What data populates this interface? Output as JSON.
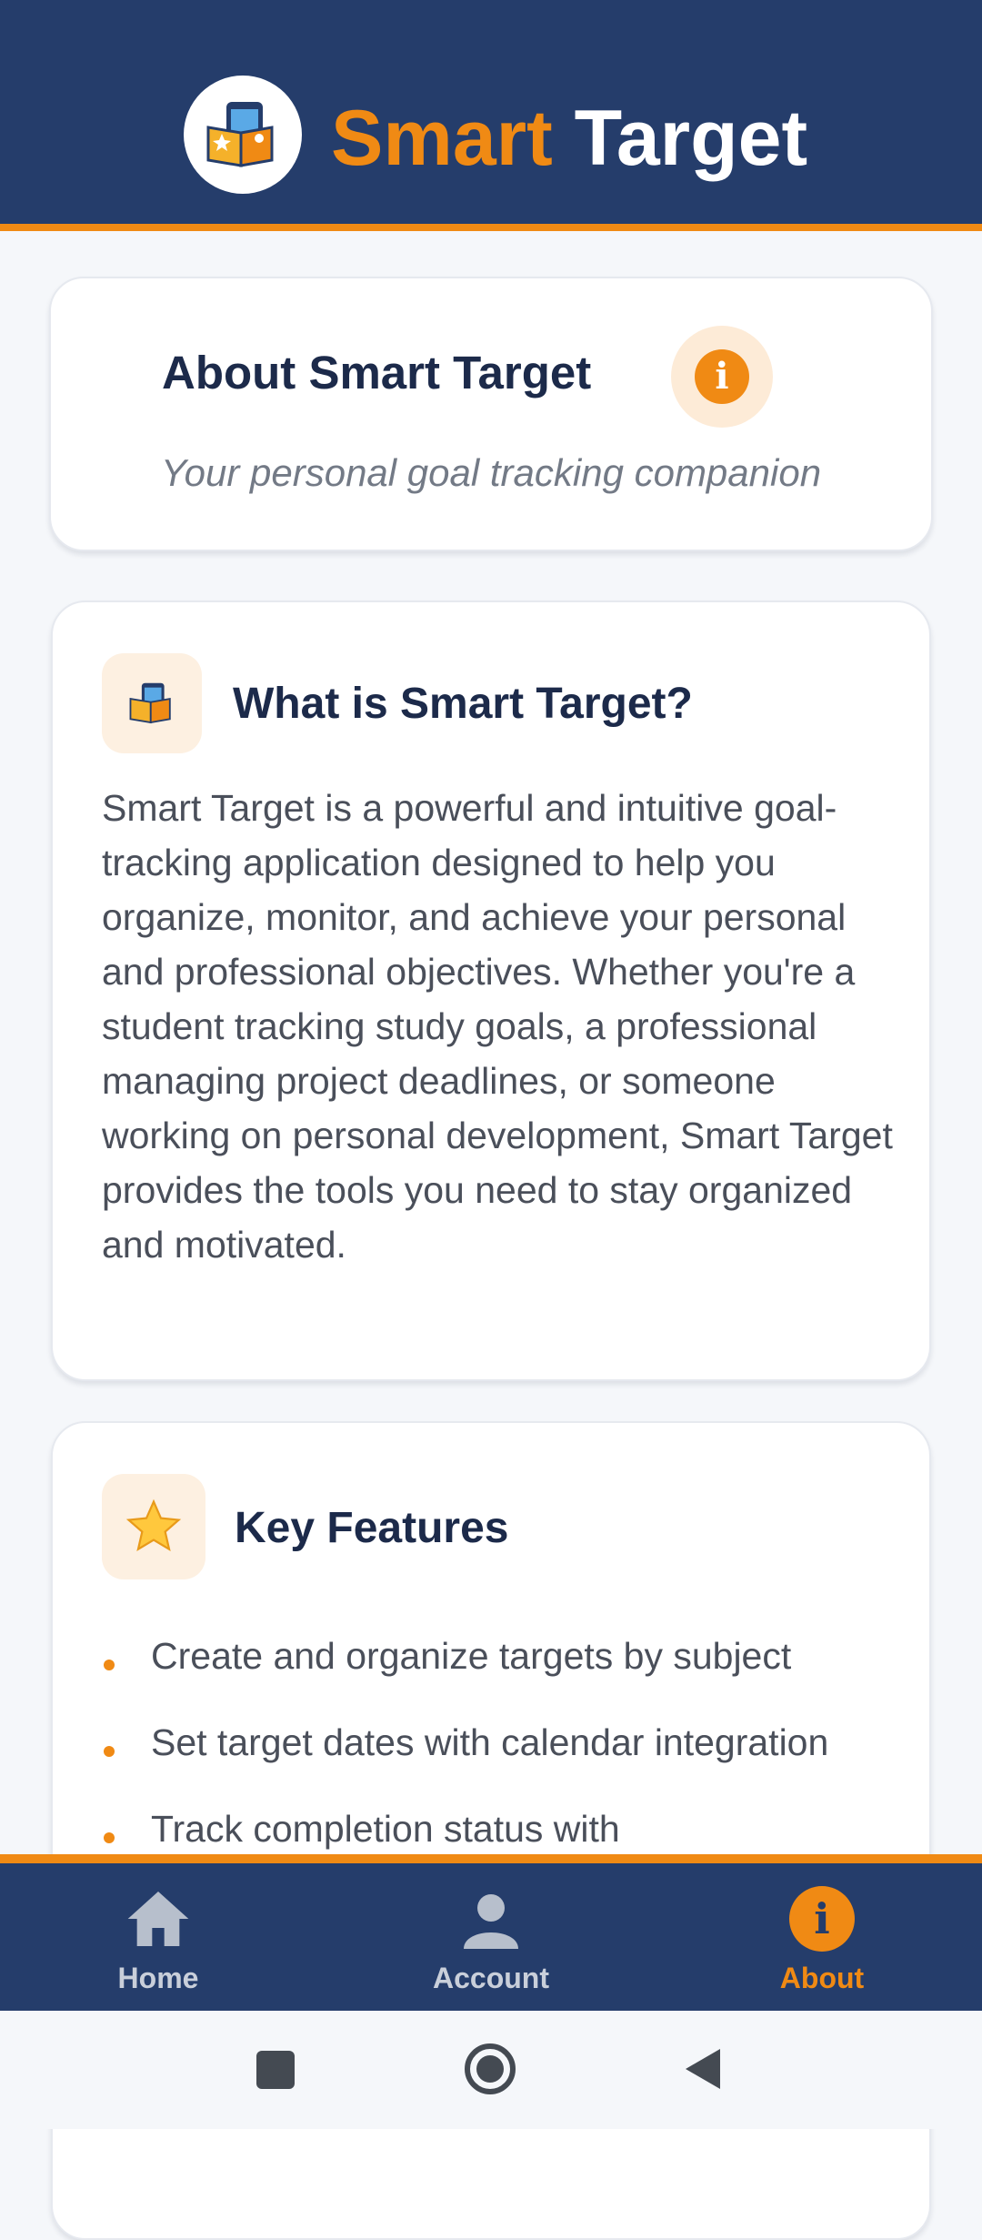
{
  "header": {
    "title_part1": "Smart",
    "title_part2": "Target",
    "colors": {
      "primary": "#253d6b",
      "accent": "#f08a14"
    }
  },
  "about_card": {
    "title": "About Smart Target",
    "icon": "info-icon",
    "subtitle": "Your personal goal tracking companion"
  },
  "what_section": {
    "icon": "app-logo-icon",
    "title": "What is Smart Target?",
    "body": "Smart Target is a powerful and intuitive goal-tracking application designed to help you organize, monitor, and achieve your personal and professional objectives. Whether you're a student tracking study goals, a professional managing project deadlines, or someone working on personal development, Smart Target provides the tools you need to stay organized and motivated."
  },
  "features_section": {
    "icon": "star-icon",
    "title": "Key Features",
    "items": [
      "Create and organize targets by subject",
      "Set target dates with calendar integration",
      "Track completion status with"
    ]
  },
  "bottom_nav": {
    "items": [
      {
        "label": "Home",
        "icon": "home-icon",
        "active": false
      },
      {
        "label": "Account",
        "icon": "account-icon",
        "active": false
      },
      {
        "label": "About",
        "icon": "info-icon",
        "active": true
      }
    ]
  },
  "system_nav": {
    "buttons": [
      "recents-icon",
      "home-circle-icon",
      "back-icon"
    ]
  }
}
